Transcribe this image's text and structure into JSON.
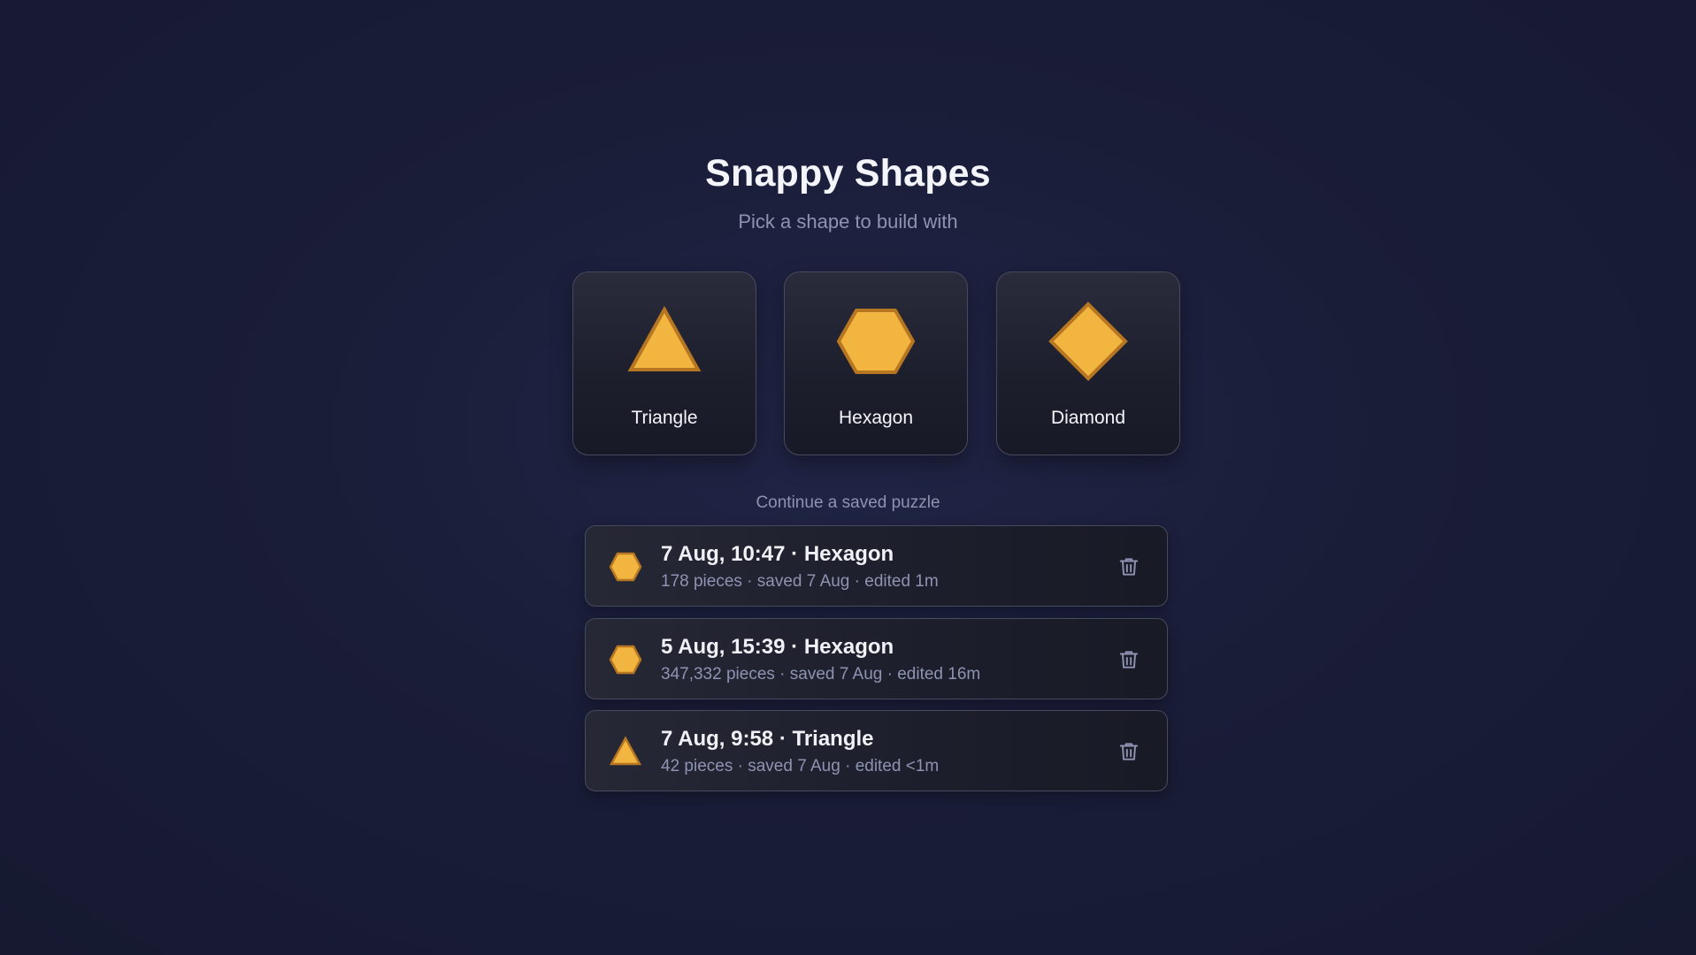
{
  "app": {
    "title": "Snappy Shapes",
    "subtitle": "Pick a shape to build with"
  },
  "colors": {
    "shape_fill": "#f2b640",
    "shape_stroke": "#b77621",
    "background": "#1a1d38"
  },
  "shapes": [
    {
      "label": "Triangle",
      "icon": "triangle-icon"
    },
    {
      "label": "Hexagon",
      "icon": "hexagon-icon"
    },
    {
      "label": "Diamond",
      "icon": "diamond-icon"
    }
  ],
  "saved": {
    "heading": "Continue a saved puzzle",
    "items": [
      {
        "title": "7 Aug, 10:47 · Hexagon",
        "meta": "178 pieces · saved 7 Aug · edited 1m",
        "icon": "hexagon-icon",
        "action_icon": "trash-icon"
      },
      {
        "title": "5 Aug, 15:39 · Hexagon",
        "meta": "347,332 pieces · saved 7 Aug · edited 16m",
        "icon": "hexagon-icon",
        "action_icon": "trash-icon"
      },
      {
        "title": "7 Aug, 9:58 · Triangle",
        "meta": "42 pieces · saved 7 Aug · edited <1m",
        "icon": "triangle-icon",
        "action_icon": "trash-icon"
      }
    ]
  }
}
